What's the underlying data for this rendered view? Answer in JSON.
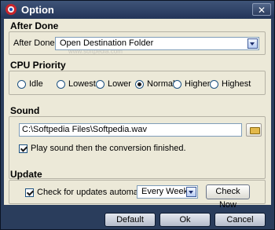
{
  "window": {
    "title": "Option",
    "close_glyph": "✕",
    "icon": "softpedia-app-icon"
  },
  "after_done": {
    "section_title": "After Done",
    "label": "After Done:",
    "selected": "Open Destination Folder"
  },
  "cpu_priority": {
    "section_title": "CPU Priority",
    "options": [
      "Idle",
      "Lowest",
      "Lower",
      "Normal",
      "Higher",
      "Highest"
    ],
    "selected": "Normal"
  },
  "sound": {
    "section_title": "Sound",
    "path": "C:\\Softpedia Files\\Softpedia.wav",
    "play_label": "Play sound then the conversion finished.",
    "play_checked": true
  },
  "update": {
    "section_title": "Update",
    "check_label": "Check for updates automatically:",
    "check_checked": true,
    "frequency": "Every Week",
    "check_now_label": "Check Now"
  },
  "footer": {
    "default_label": "Default",
    "ok_label": "Ok",
    "cancel_label": "Cancel"
  },
  "watermark": "www.softpedia.com"
}
